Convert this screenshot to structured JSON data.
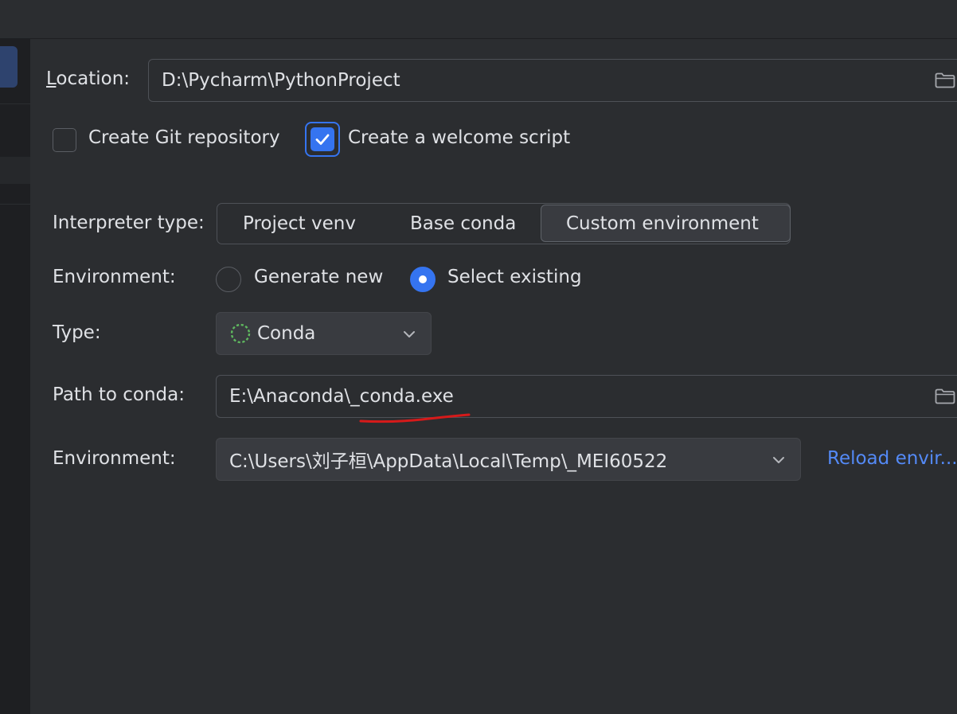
{
  "form": {
    "location": {
      "label_first": "L",
      "label_rest": "ocation:",
      "value": "D:\\Pycharm\\PythonProject"
    },
    "checkboxes": [
      {
        "label": "Create Git repository",
        "checked": false
      },
      {
        "label": "Create a welcome script",
        "checked": true
      }
    ],
    "interpreter_type": {
      "label": "Interpreter type:",
      "options": [
        "Project venv",
        "Base conda",
        "Custom environment"
      ],
      "selected": "Custom environment"
    },
    "environment_mode": {
      "label": "Environment:",
      "options": [
        {
          "label": "Generate new",
          "selected": false
        },
        {
          "label": "Select existing",
          "selected": true
        }
      ]
    },
    "type": {
      "label": "Type:",
      "value": "Conda",
      "icon": "conda-spinner-icon"
    },
    "path_to_conda": {
      "label": "Path to conda:",
      "value": "E:\\Anaconda\\_conda.exe"
    },
    "environment": {
      "label": "Environment:",
      "value": "C:\\Users\\刘子桓\\AppData\\Local\\Temp\\_MEI60522",
      "reload_link": "Reload envir..."
    }
  },
  "colors": {
    "accent": "#3574f0",
    "link": "#548af7",
    "annotation": "#d61a1a",
    "conda_icon": "#5fb85f"
  }
}
